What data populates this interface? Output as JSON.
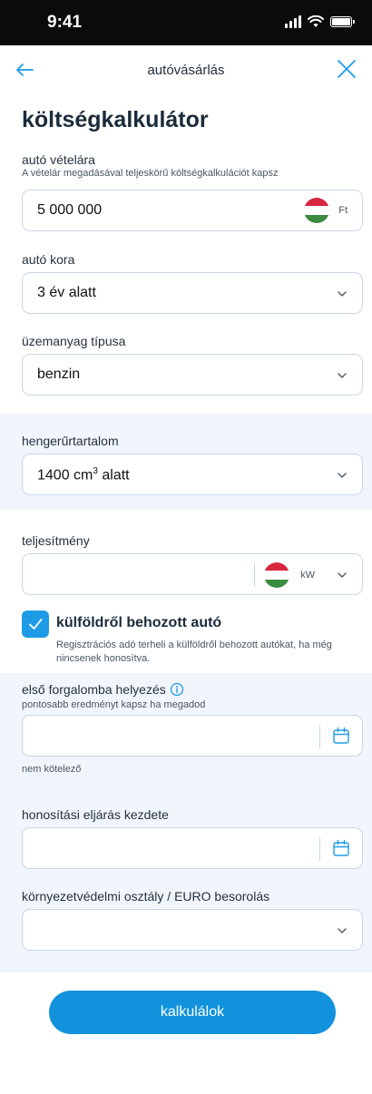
{
  "status_bar": {
    "time": "9:41"
  },
  "nav": {
    "title": "autóvásárlás",
    "back_icon": "arrow-left-icon",
    "close_icon": "close-icon"
  },
  "page": {
    "title": "költségkalkulátor"
  },
  "price": {
    "label": "autó vételára",
    "hint": "A vételár megadásával teljeskörű költségkalkulációt kapsz",
    "value": "5 000 000",
    "currency": "Ft",
    "flag_icon": "hungary-flag-icon"
  },
  "car_age": {
    "label": "autó kora",
    "value": "3 év alatt"
  },
  "fuel_type": {
    "label": "üzemanyag típusa",
    "value": "benzin"
  },
  "engine": {
    "label": "hengerűrtartalom",
    "value_prefix": "1400 cm",
    "value_sup": "3",
    "value_suffix": " alatt"
  },
  "power": {
    "label": "teljesítmény",
    "value": "",
    "unit": "kW"
  },
  "imported": {
    "checked": true,
    "label": "külföldről behozott autó",
    "description": "Regisztrációs adó terheli a külföldről behozott autókat, ha még nincsenek honosítva."
  },
  "first_registration": {
    "label": "első forgalomba helyezés",
    "hint": "pontosabb eredményt kapsz ha megadod",
    "value": "",
    "note": "nem kötelező"
  },
  "naturalization_start": {
    "label": "honosítási eljárás kezdete",
    "value": ""
  },
  "euro_class": {
    "label": "környezetvédelmi osztály / EURO besorolás",
    "value": ""
  },
  "cta": {
    "label": "kalkulálok"
  },
  "colors": {
    "accent": "#1292dc",
    "field_border": "#c9d6e8",
    "shade": "#f1f6fc",
    "flag_red": "#d7263d",
    "flag_white": "#ffffff",
    "flag_green": "#3a8a3f"
  }
}
